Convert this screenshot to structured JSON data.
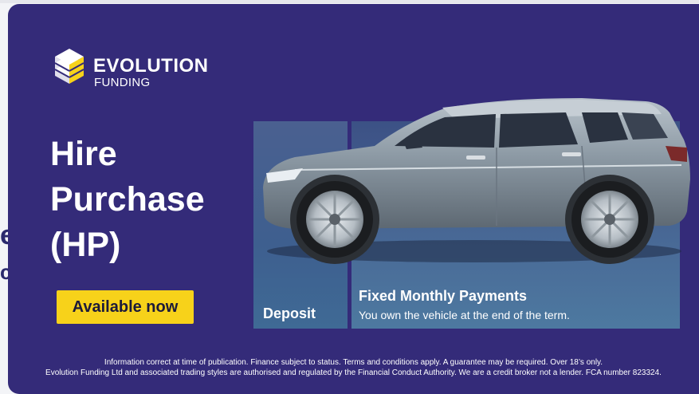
{
  "background": {
    "text_1": "e",
    "text_2": "c"
  },
  "ad": {
    "brand": {
      "word1": "EVOLUTION",
      "word2": "FUNDING"
    },
    "headline": [
      "Hire",
      "Purchase",
      "(HP)"
    ],
    "cta_label": "Available now",
    "deposit_label": "Deposit",
    "monthly": {
      "title": "Fixed Monthly Payments",
      "subtitle": "You own the vehicle at the end of the term."
    },
    "disclaimer": [
      "Information correct at time of publication. Finance subject to status. Terms and conditions apply. A guarantee may be required. Over 18’s only.",
      "Evolution Funding Ltd and associated trading styles are authorised and regulated by the Financial Conduct Authority. We are a credit broker not a lender. FCA number 823324."
    ]
  },
  "colors": {
    "ad_background": "#342b79",
    "cta_background": "#f7d21a",
    "logo_accent": "#f7d21a"
  }
}
